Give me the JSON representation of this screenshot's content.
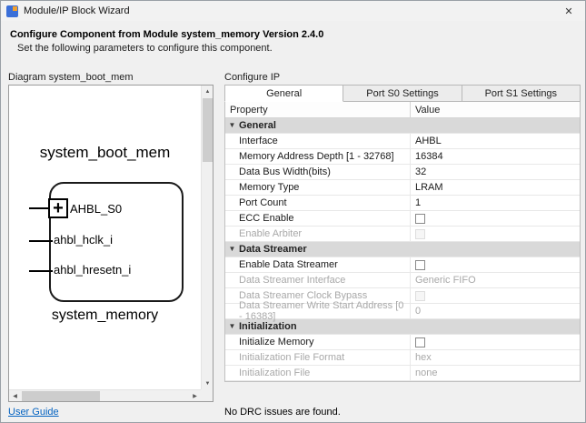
{
  "window": {
    "title": "Module/IP Block Wizard"
  },
  "icons": {
    "close": "✕",
    "collapse": "▼",
    "plus": "+",
    "up": "▲",
    "down": "▼",
    "left": "◀",
    "right": "▶"
  },
  "colors": {
    "link": "#0563c1",
    "section_bg": "#d9d9d9",
    "tab_active_bg": "#ffffff"
  },
  "header": {
    "title": "Configure Component from Module system_memory Version 2.4.0",
    "subtitle": "Set the following parameters to configure this component."
  },
  "diagram": {
    "label": "Diagram system_boot_mem",
    "instance_name": "system_boot_mem",
    "module_name": "system_memory",
    "ports": [
      {
        "name": "AHBL_S0",
        "expandable": true
      },
      {
        "name": "ahbl_hclk_i"
      },
      {
        "name": "ahbl_hresetn_i"
      }
    ],
    "user_guide_label": "User Guide"
  },
  "configure": {
    "label": "Configure IP",
    "tabs": [
      "General",
      "Port S0 Settings",
      "Port S1 Settings"
    ],
    "active_tab": 0,
    "columns": [
      "Property",
      "Value"
    ],
    "rows": [
      {
        "type": "section",
        "label": "General"
      },
      {
        "type": "text",
        "label": "Interface",
        "value": "AHBL",
        "disabled": false
      },
      {
        "type": "text",
        "label": "Memory Address Depth  [1 - 32768]",
        "value": "16384",
        "disabled": false
      },
      {
        "type": "text",
        "label": "Data Bus Width(bits)",
        "value": "32",
        "disabled": false
      },
      {
        "type": "text",
        "label": "Memory Type",
        "value": "LRAM",
        "disabled": false
      },
      {
        "type": "text",
        "label": "Port Count",
        "value": "1",
        "disabled": false
      },
      {
        "type": "checkbox",
        "label": "ECC Enable",
        "checked": false,
        "disabled": false
      },
      {
        "type": "checkbox",
        "label": "Enable Arbiter",
        "checked": false,
        "disabled": true
      },
      {
        "type": "section",
        "label": "Data Streamer"
      },
      {
        "type": "checkbox",
        "label": "Enable Data Streamer",
        "checked": false,
        "disabled": false
      },
      {
        "type": "text",
        "label": "Data Streamer Interface",
        "value": "Generic FIFO",
        "disabled": true
      },
      {
        "type": "checkbox",
        "label": "Data Streamer Clock Bypass",
        "checked": false,
        "disabled": true
      },
      {
        "type": "text",
        "label": "Data Streamer Write Start Address  [0 - 16383]",
        "value": "0",
        "disabled": true
      },
      {
        "type": "section",
        "label": "Initialization"
      },
      {
        "type": "checkbox",
        "label": "Initialize Memory",
        "checked": false,
        "disabled": false
      },
      {
        "type": "text",
        "label": "Initialization File Format",
        "value": "hex",
        "disabled": true
      },
      {
        "type": "text",
        "label": "Initialization File",
        "value": "none",
        "disabled": true
      }
    ],
    "status": "No DRC issues are found."
  }
}
